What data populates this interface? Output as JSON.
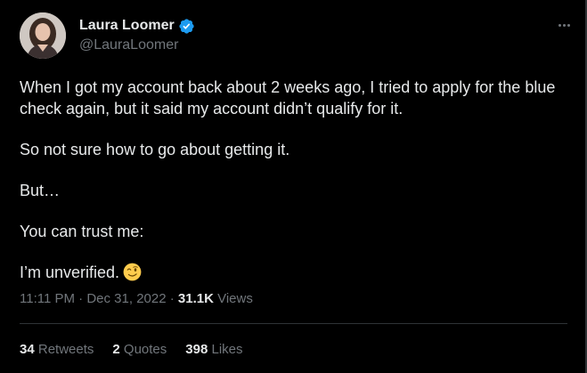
{
  "author": {
    "display_name": "Laura Loomer",
    "handle": "@LauraLoomer",
    "verified_badge": "verified-badge-icon",
    "avatar": "avatar-photo"
  },
  "more_menu": "more-options-icon",
  "tweet": {
    "paragraphs": [
      "When I got my account back about 2 weeks ago, I tried to apply for the blue check again, but it said my account didn’t qualify for it.",
      "So not sure how to go about getting it.",
      "But…",
      "You can trust me:",
      "I’m unverified."
    ],
    "emoji": "winking-face-emoji"
  },
  "meta": {
    "time": "11:11 PM",
    "separator": "·",
    "date": "Dec 31, 2022",
    "views_count": "31.1K",
    "views_label": "Views"
  },
  "stats": {
    "retweets_count": "34",
    "retweets_label": "Retweets",
    "quotes_count": "2",
    "quotes_label": "Quotes",
    "likes_count": "398",
    "likes_label": "Likes"
  },
  "colors": {
    "background": "#000000",
    "primary_text": "#e7e9ea",
    "secondary_text": "#71767b",
    "verified_blue": "#1d9bf0",
    "divider": "#2f3336"
  }
}
